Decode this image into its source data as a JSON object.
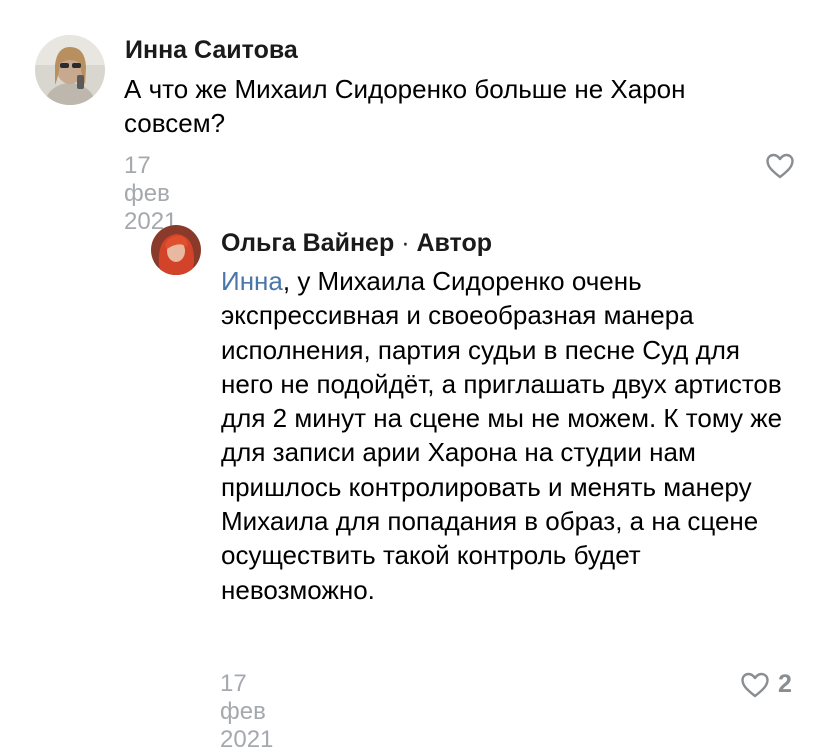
{
  "comments": [
    {
      "author": "Инна Саитова",
      "text": "А что же Михаил Сидоренко больше не Харон совсем?",
      "date": "17 фев 2021",
      "likes": ""
    },
    {
      "author": "Ольга Вайнер",
      "author_separator": "·",
      "author_badge": "Автор",
      "mention": "Инна",
      "text": ", у Михаила Сидоренко очень экспрессивная и своеобразная манера исполнения, партия судьи в песне Суд для него не подойдёт, а приглашать двух артистов для 2 минут на сцене мы не можем. К тому же для записи арии Харона на студии нам пришлось контролировать и менять манеру Михаила для попадания в образ, а на сцене осуществить такой контроль будет невозможно.",
      "date": "17 фев 2021",
      "likes": "2"
    }
  ],
  "icons": {
    "like": "heart-outline-icon",
    "avatar": "avatar-photo"
  },
  "colors": {
    "mention": "#4a76a8",
    "date": "#a5a9ae",
    "like_icon": "#8a8d91"
  }
}
